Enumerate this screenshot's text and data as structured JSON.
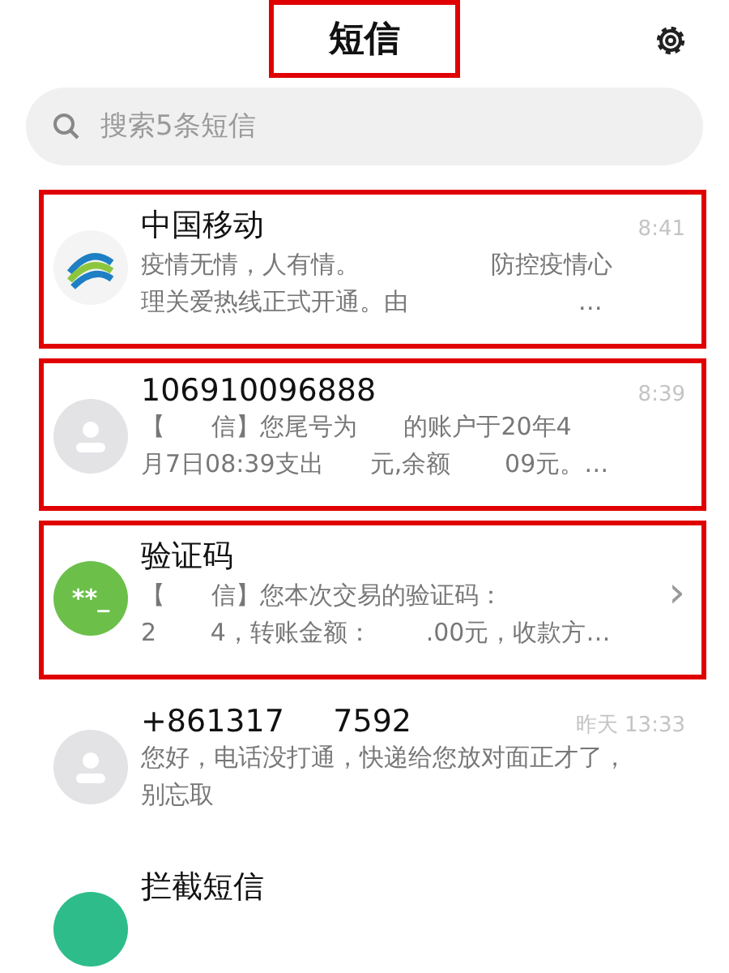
{
  "header": {
    "title": "短信",
    "highlighted": true
  },
  "search": {
    "placeholder": "搜索5条短信"
  },
  "messages": [
    {
      "avatar": {
        "kind": "logo"
      },
      "name": "中国移动",
      "time": "8:41",
      "highlighted": true,
      "lines": [
        "疫情无情，人有情。                 防控疫情心",
        "理关爱热线正式开通。由                      …"
      ]
    },
    {
      "avatar": {
        "kind": "person"
      },
      "name": "106910096888",
      "time": "8:39",
      "highlighted": true,
      "lines": [
        "【      信】您尾号为      的账户于20年4",
        "月7日08:39支出      元,余额       09元。…"
      ]
    },
    {
      "avatar": {
        "kind": "code",
        "text": "**_"
      },
      "name": "验证码",
      "chevron": "›",
      "highlighted": true,
      "lines": [
        "【      信】您本次交易的验证码：",
        "2       4，转账金额：       .00元，收款方…"
      ]
    },
    {
      "avatar": {
        "kind": "person"
      },
      "name": "+861317     7592",
      "time": "昨天 13:33",
      "highlighted": false,
      "lines": [
        "您好，电话没打通，快递给您放对面正才了，",
        "别忘取"
      ]
    },
    {
      "avatar": {
        "kind": "blocked"
      },
      "name": "拦截短信",
      "highlighted": false
    }
  ]
}
